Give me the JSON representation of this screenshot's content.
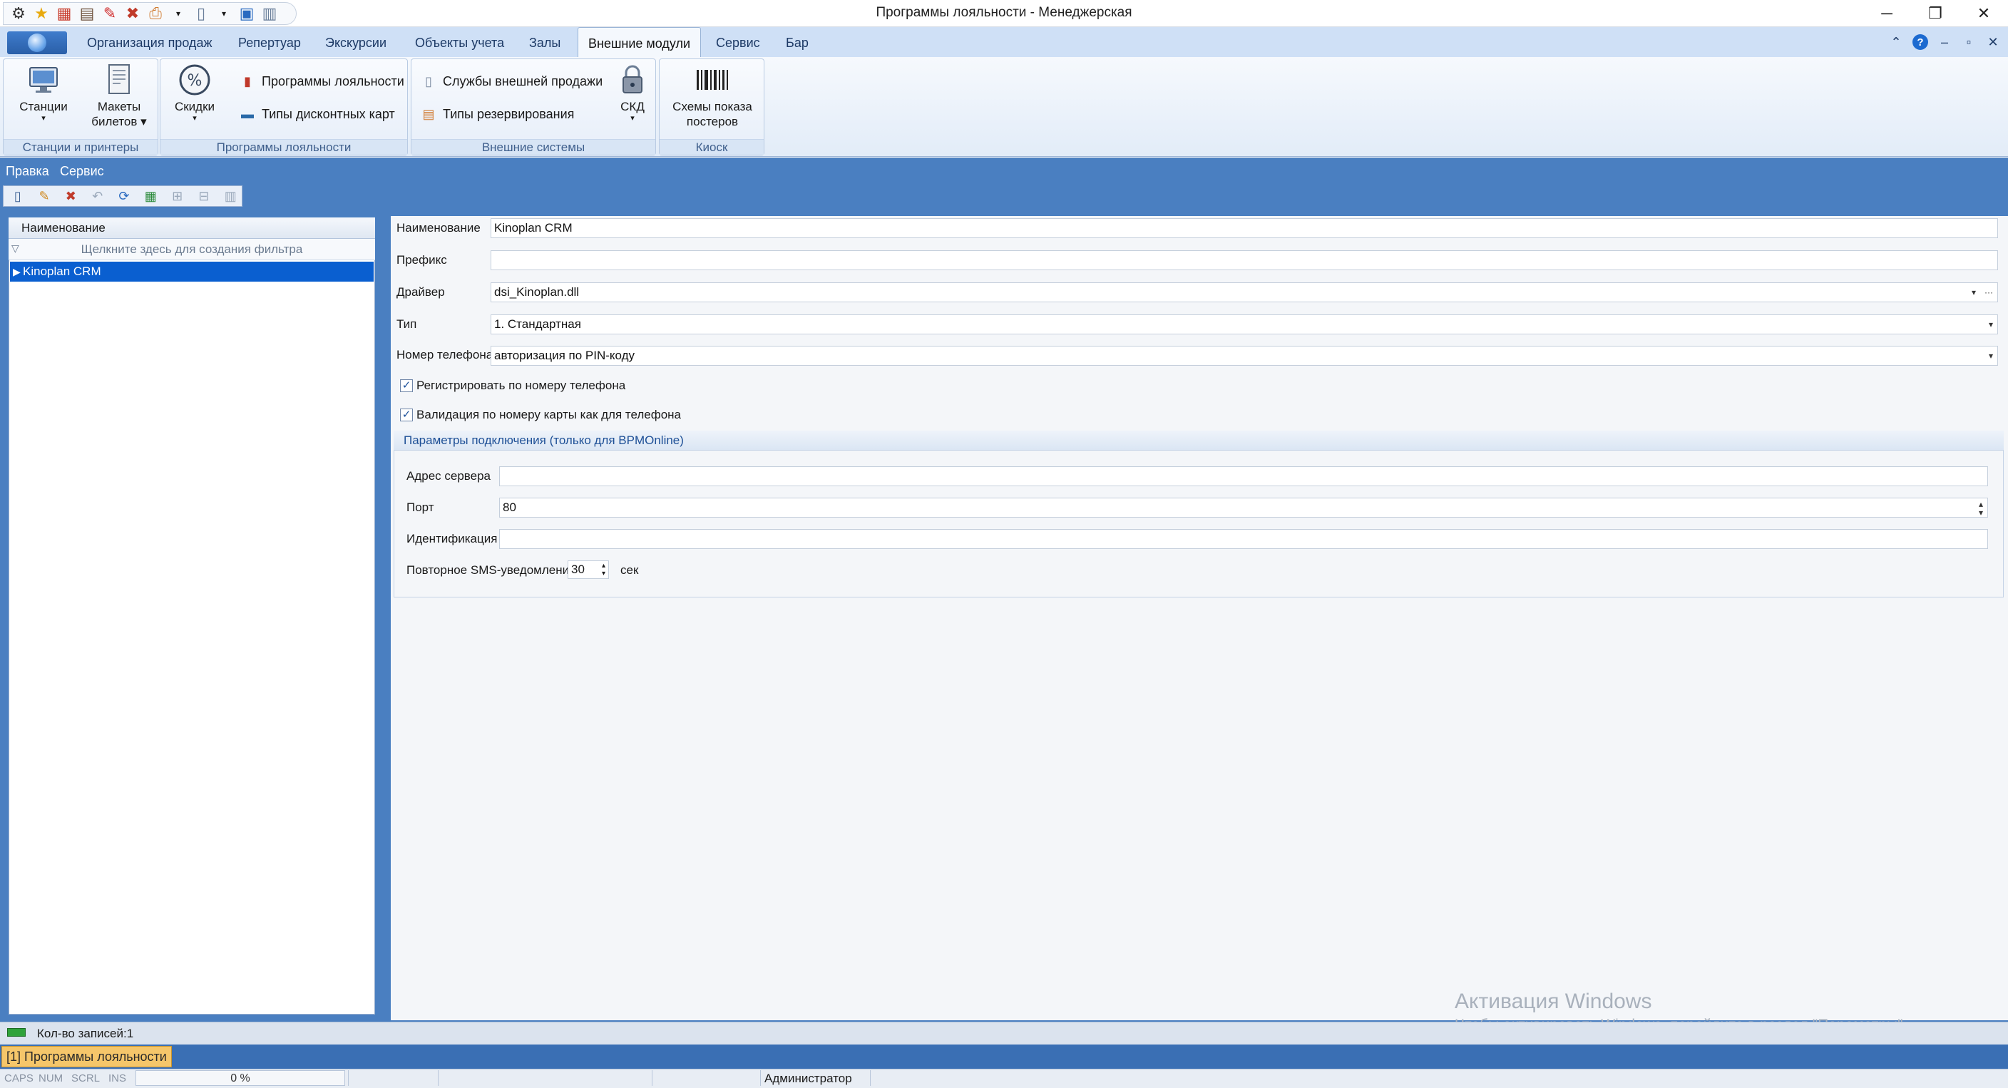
{
  "window": {
    "title": "Программы лояльности - Менеджерская",
    "minimize": "─",
    "restore": "❐",
    "close": "✕"
  },
  "ribbon_tabs": [
    "Организация продаж",
    "Репертуар",
    "Экскурсии",
    "Объекты учета",
    "Залы",
    "Внешние модули",
    "Сервис",
    "Бар"
  ],
  "ribbon_active_tab": "Внешние модули",
  "ribbon_right": {
    "collapse": "⌃",
    "help": "?",
    "min": "–",
    "restore": "▫",
    "close": "✕"
  },
  "ribbon": {
    "group1": {
      "label": "Станции и принтеры",
      "stations": "Станции",
      "tickets_line1": "Макеты",
      "tickets_line2": "билетов ▾"
    },
    "group2": {
      "label": "Программы лояльности",
      "discounts": "Скидки",
      "loyalty": "Программы лояльности",
      "discount_cards": "Типы дисконтных карт"
    },
    "group3": {
      "label": "Внешние системы",
      "external_sales": "Службы внешней продажи",
      "reservation_types": "Типы резервирования",
      "skd": "СКД"
    },
    "group4": {
      "label": "Киоск",
      "posters_line1": "Схемы показа",
      "posters_line2": "постеров"
    }
  },
  "menu": {
    "edit": "Правка",
    "service": "Сервис"
  },
  "grid": {
    "header": "Наименование",
    "filter_hint": "Щелкните здесь для создания фильтра",
    "rows": [
      {
        "name": "Kinoplan CRM"
      }
    ]
  },
  "form": {
    "name_label": "Наименование",
    "name_value": "Kinoplan CRM",
    "prefix_label": "Префикс",
    "prefix_value": "",
    "driver_label": "Драйвер",
    "driver_value": "dsi_Kinoplan.dll",
    "type_label": "Тип",
    "type_value": "1. Стандартная",
    "phone_label": "Номер телефона",
    "phone_value": "авторизация по PIN-коду",
    "register_by_phone": "Регистрировать по номеру телефона",
    "validate_card": "Валидация по номеру карты как для телефона",
    "conn_group": "Параметры подключения (только для BPMOnline)",
    "server_label": "Адрес сервера",
    "server_value": "",
    "port_label": "Порт",
    "port_value": "80",
    "ident_label": "Идентификация",
    "ident_value": "",
    "sms_label": "Повторное SMS-уведомление",
    "sms_value": "30",
    "sms_unit": "сек"
  },
  "watermark": {
    "line1": "Активация Windows",
    "line2": "Чтобы активировать Windows, перейдите в раздел \"Параметры\"."
  },
  "status": {
    "records": "Кол-во записей:1",
    "window_tab": "[1] Программы лояльности",
    "caps": "CAPS",
    "num": "NUM",
    "scrl": "SCRL",
    "ins": "INS",
    "progress": "0 %",
    "user": "Администратор"
  },
  "colors": {
    "accent": "#4a7fc1",
    "selection": "#0a5fd0",
    "ribbon_bg": "#cfe0f6"
  }
}
